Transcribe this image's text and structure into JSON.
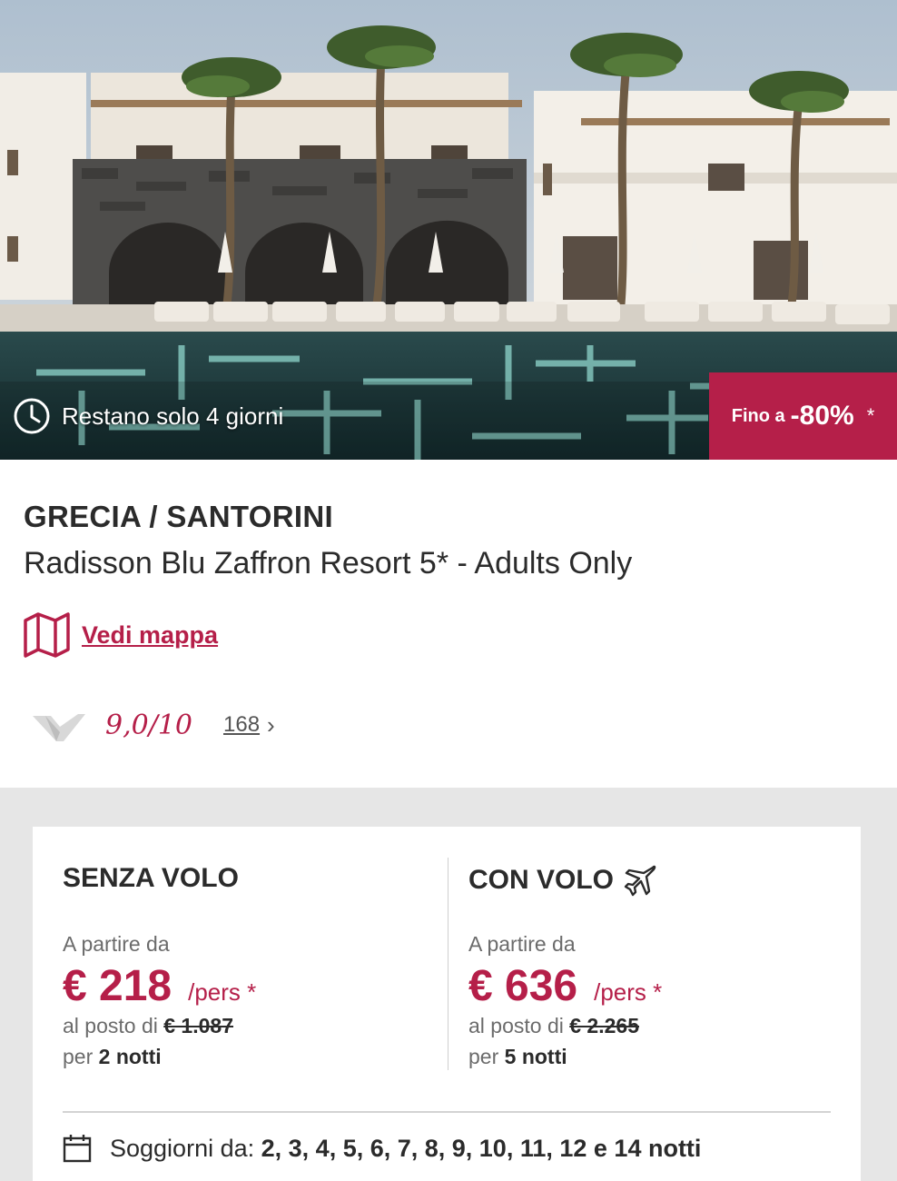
{
  "hero": {
    "countdown": "Restano solo 4 giorni",
    "discount_prefix": "Fino a",
    "discount_value": "-80%",
    "discount_note": "*"
  },
  "offer": {
    "destination": "GRECIA / SANTORINI",
    "hotel_name": "Radisson Blu Zaffron Resort 5* - Adults Only",
    "map_label": "Vedi mappa",
    "rating_score": "9,0/10",
    "review_count": "168"
  },
  "pricing": {
    "without_flight": {
      "title": "SENZA VOLO",
      "from_label": "A partire da",
      "price": "€ 218",
      "unit": "/pers *",
      "instead_label": "al posto di",
      "old_price": "€ 1.087",
      "per_label": "per",
      "nights": "2 notti"
    },
    "with_flight": {
      "title": "CON VOLO",
      "from_label": "A partire da",
      "price": "€ 636",
      "unit": "/pers *",
      "instead_label": "al posto di",
      "old_price": "€ 2.265",
      "per_label": "per",
      "nights": "5 notti"
    },
    "stays_label": "Soggiorni da:",
    "stays_values": "2, 3, 4, 5, 6, 7, 8, 9, 10, 11, 12 e 14 notti"
  },
  "colors": {
    "accent": "#b51f49",
    "panel_bg": "#e6e6e6"
  },
  "icons": {
    "clock": "clock-icon",
    "map": "map-icon",
    "plane": "plane-icon",
    "calendar": "calendar-icon",
    "rating_logo": "rating-logo-icon",
    "chevron": "chevron-right-icon"
  }
}
